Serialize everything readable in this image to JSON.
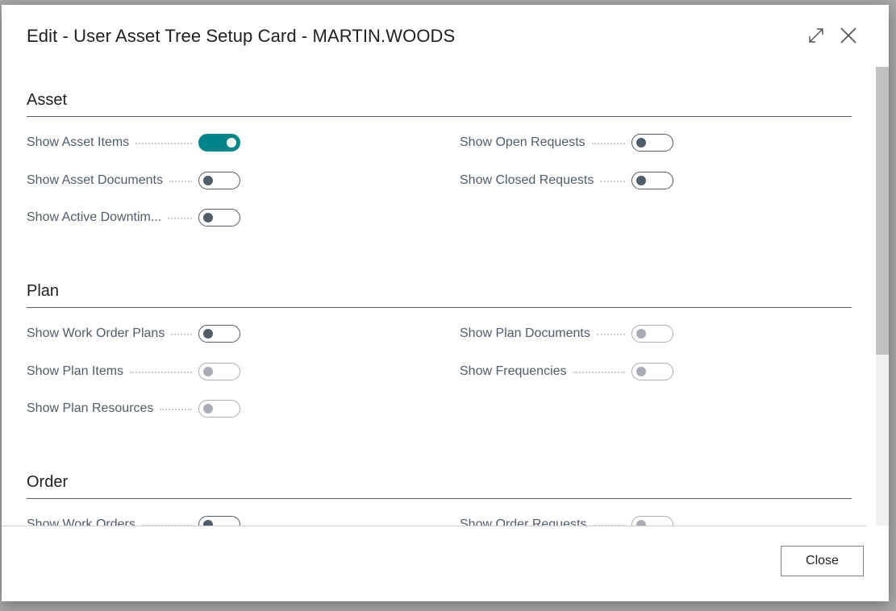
{
  "dialog": {
    "title": "Edit - User Asset Tree Setup Card - MARTIN.WOODS",
    "close_label": "Close"
  },
  "colors": {
    "accent": "#008489",
    "toggle_off": "#505c6a",
    "toggle_disabled": "#a9adb3"
  },
  "sections": [
    {
      "title": "Asset",
      "fields": [
        {
          "label": "Show Asset Items",
          "on": true,
          "disabled": false
        },
        {
          "label": "Show Open Requests",
          "on": false,
          "disabled": false
        },
        {
          "label": "Show Asset Documents",
          "on": false,
          "disabled": false
        },
        {
          "label": "Show Closed Requests",
          "on": false,
          "disabled": false
        },
        {
          "label": "Show Active Downtim...",
          "on": false,
          "disabled": false
        }
      ]
    },
    {
      "title": "Plan",
      "fields": [
        {
          "label": "Show Work Order Plans",
          "on": false,
          "disabled": false
        },
        {
          "label": "Show Plan Documents",
          "on": false,
          "disabled": true
        },
        {
          "label": "Show Plan Items",
          "on": false,
          "disabled": true
        },
        {
          "label": "Show Frequencies",
          "on": false,
          "disabled": true
        },
        {
          "label": "Show Plan Resources",
          "on": false,
          "disabled": true
        }
      ]
    },
    {
      "title": "Order",
      "fields": [
        {
          "label": "Show Work Orders",
          "on": false,
          "disabled": false
        },
        {
          "label": "Show Order Requests",
          "on": false,
          "disabled": true
        }
      ]
    }
  ]
}
